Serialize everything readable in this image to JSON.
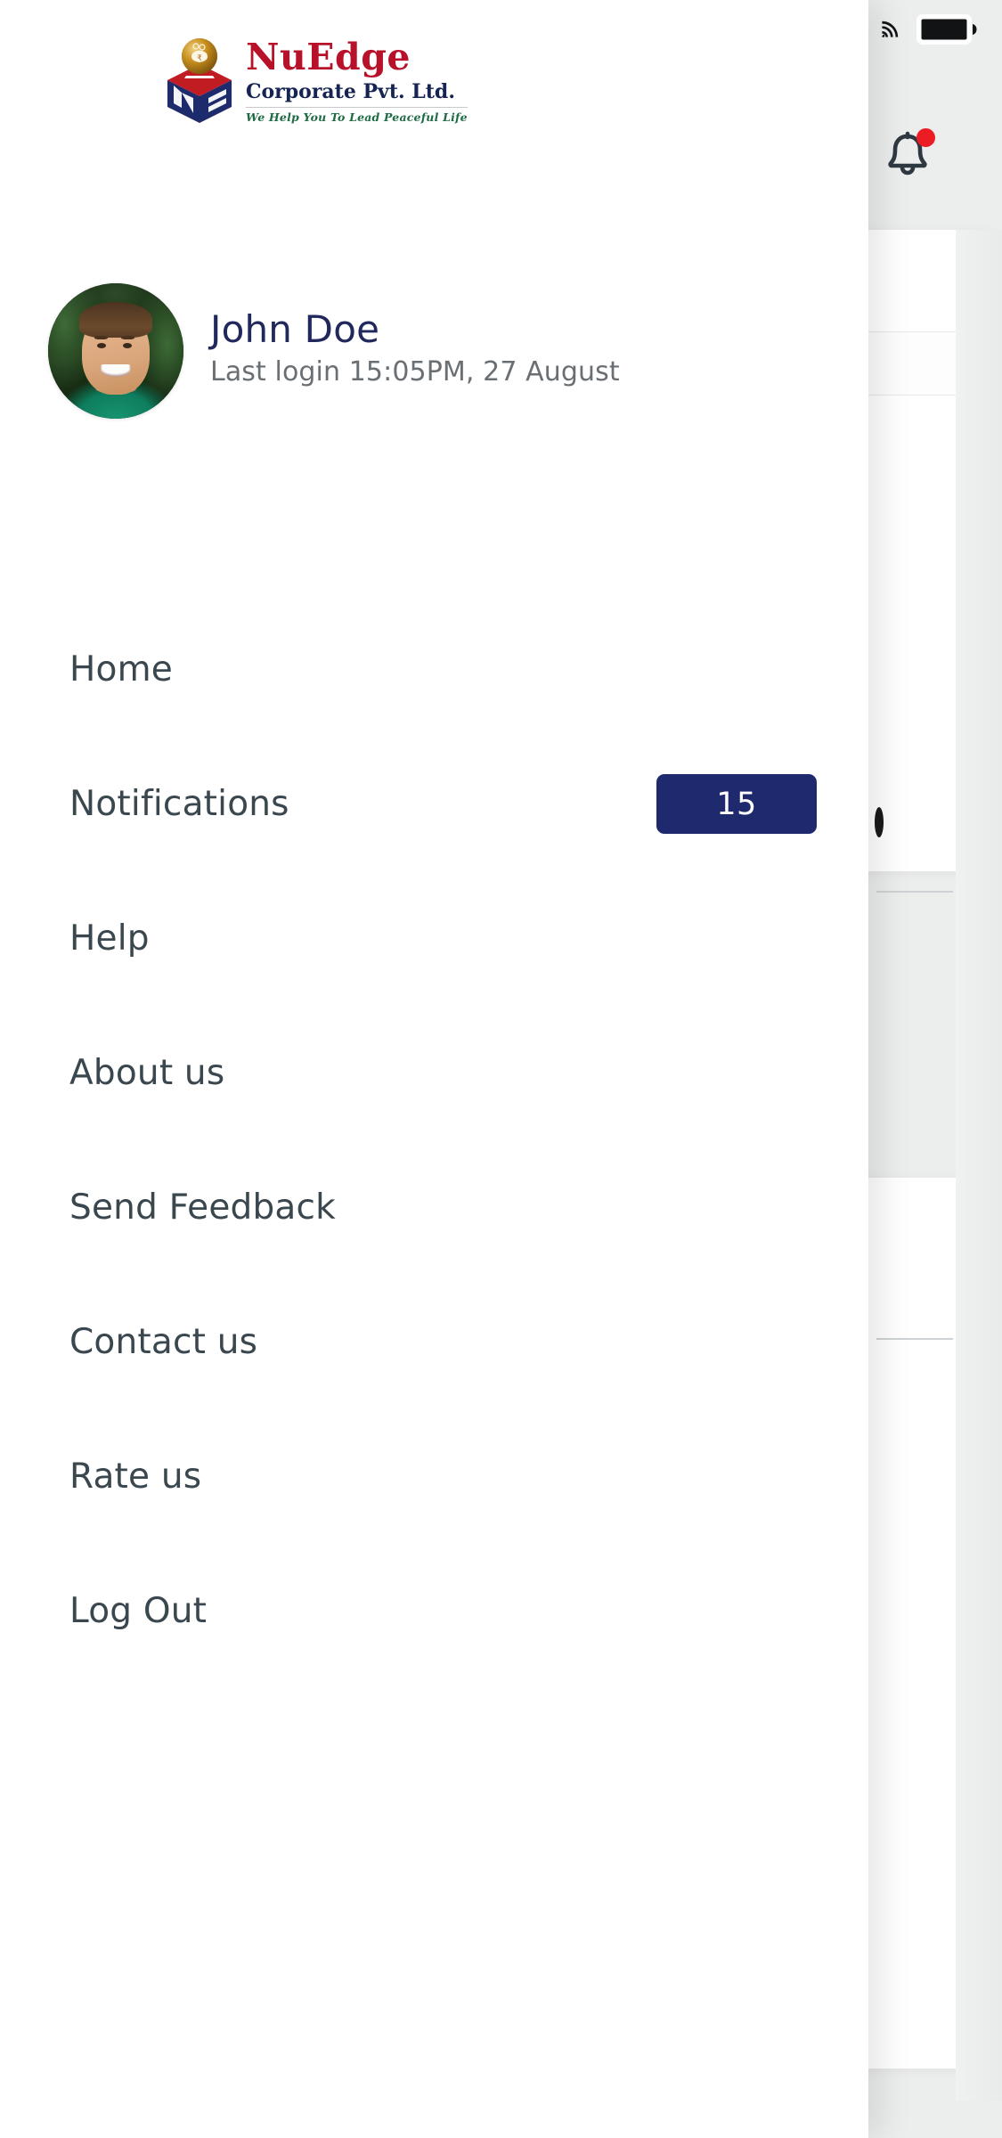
{
  "statusbar": {
    "wifi_icon": "wifi-icon",
    "battery_icon": "battery-full-icon"
  },
  "brand": {
    "name": "NuEdge",
    "subtitle": "Corporate Pvt. Ltd.",
    "tagline": "We Help You To Lead Peaceful Life",
    "mark_icon": "nuedge-cube-logo-icon",
    "colors": {
      "name": "#b8122b",
      "subtitle": "#152452",
      "tagline": "#1d6b43"
    }
  },
  "header": {
    "notifications_bell_icon": "bell-icon",
    "bell_badge_color": "#ec1c24",
    "has_unread": true
  },
  "profile": {
    "avatar_icon": "user-avatar-photo",
    "name": "John Doe",
    "last_login": "Last login 15:05PM, 27 August",
    "name_color": "#21285c",
    "last_login_color": "#6a6f74"
  },
  "menu": {
    "items": [
      {
        "label": "Home",
        "badge": null
      },
      {
        "label": "Notifications",
        "badge": "15"
      },
      {
        "label": "Help",
        "badge": null
      },
      {
        "label": "About us",
        "badge": null
      },
      {
        "label": "Send Feedback",
        "badge": null
      },
      {
        "label": "Contact us",
        "badge": null
      },
      {
        "label": "Rate us",
        "badge": null
      },
      {
        "label": "Log Out",
        "badge": null
      }
    ],
    "badge_bg": "#1f2a6e",
    "badge_text_color": "#ffffff",
    "label_color": "#3a474e"
  },
  "background_screen": {
    "backdrop_color": "#eceded",
    "card_color": "#ffffff"
  }
}
